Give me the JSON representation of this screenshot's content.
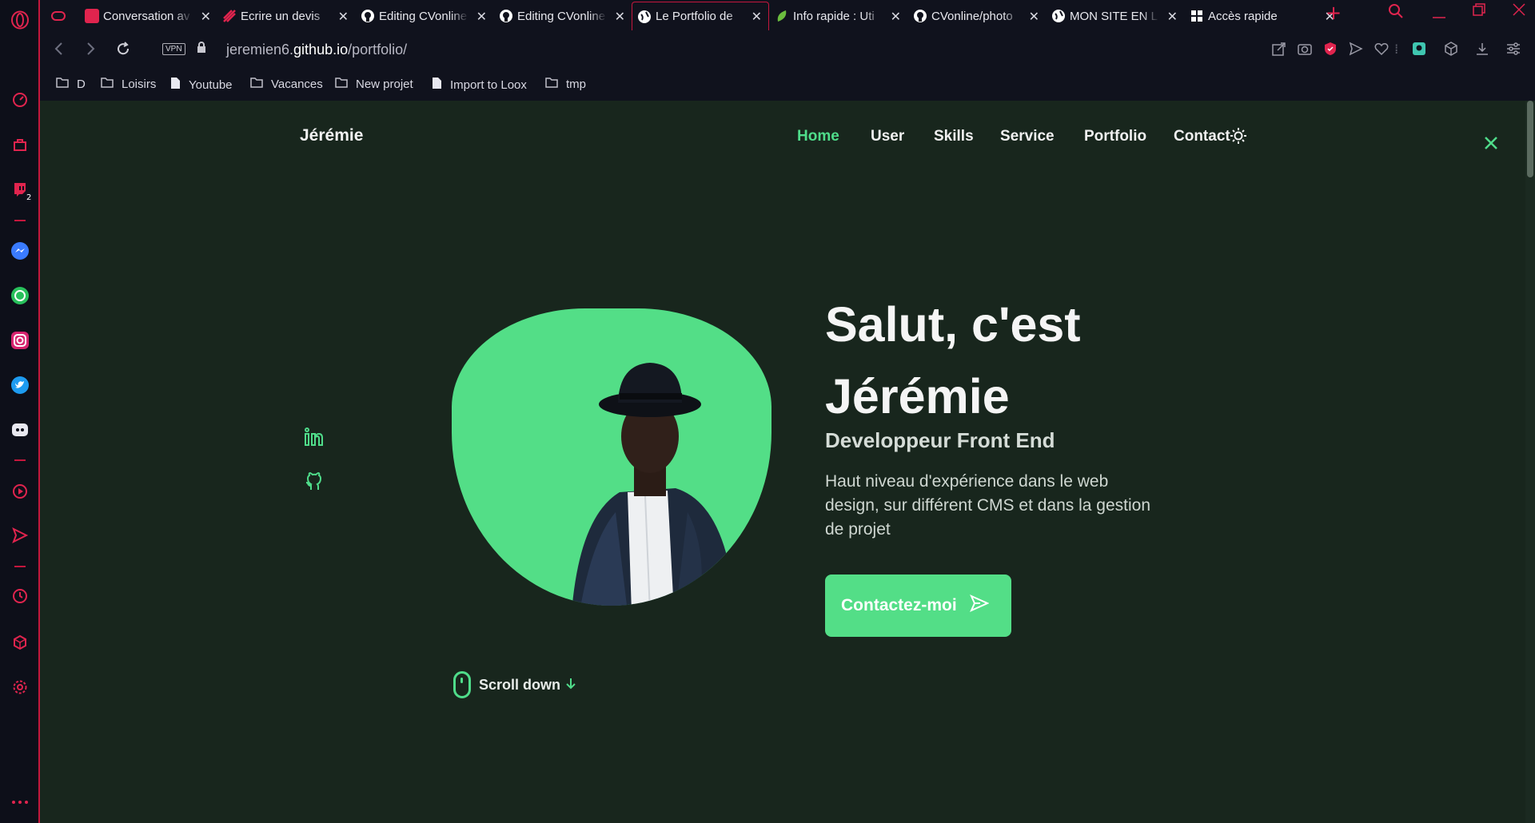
{
  "tabs": [
    {
      "label": "Conversation av",
      "icon": "app-icon",
      "color": "#e0244e"
    },
    {
      "label": "Ecrire un devis",
      "icon": "app-icon",
      "color": "#e0244e"
    },
    {
      "label": "Editing CVonline",
      "icon": "github-icon",
      "color": "#ffffff"
    },
    {
      "label": "Editing CVonline",
      "icon": "github-icon",
      "color": "#ffffff"
    },
    {
      "label": "Le Portfolio de",
      "icon": "globe-icon",
      "color": "#ffffff",
      "active": true
    },
    {
      "label": "Info rapide : Uti",
      "icon": "leaf-icon",
      "color": "#6bbd3e"
    },
    {
      "label": "CVonline/photo",
      "icon": "github-icon",
      "color": "#ffffff"
    },
    {
      "label": "MON SITE EN L",
      "icon": "globe-icon",
      "color": "#ffffff"
    },
    {
      "label": "Accès rapide",
      "icon": "grid-icon",
      "color": "#ffffff"
    }
  ],
  "address": {
    "vpn": "VPN",
    "url_prefix": "jeremien6.",
    "url_domain": "github.io",
    "url_path": "/portfolio/"
  },
  "bookmarks": [
    {
      "label": "D",
      "icon": "folder-icon"
    },
    {
      "label": "Loisirs",
      "icon": "folder-icon"
    },
    {
      "label": "Youtube",
      "icon": "file-icon"
    },
    {
      "label": "Vacances",
      "icon": "folder-icon"
    },
    {
      "label": "New projet",
      "icon": "folder-icon"
    },
    {
      "label": "Import to Loox",
      "icon": "file-icon"
    },
    {
      "label": "tmp",
      "icon": "folder-icon"
    }
  ],
  "sidebar": {
    "badge": "2"
  },
  "site": {
    "logo": "Jérémie",
    "nav": [
      "Home",
      "User",
      "Skills",
      "Service",
      "Portfolio",
      "Contact"
    ],
    "active_nav": "Home",
    "hero_title_line1": "Salut, c'est",
    "hero_title_line2": "Jérémie",
    "hero_subtitle": "Developpeur Front End",
    "hero_description": "Haut niveau d'expérience dans le web design, sur différent CMS et dans la gestion de projet",
    "cta_label": "Contactez-moi",
    "scroll_label": "Scroll down",
    "social": [
      "linkedin-icon",
      "github-icon"
    ],
    "accent": "#53de87",
    "background": "#18261d"
  }
}
